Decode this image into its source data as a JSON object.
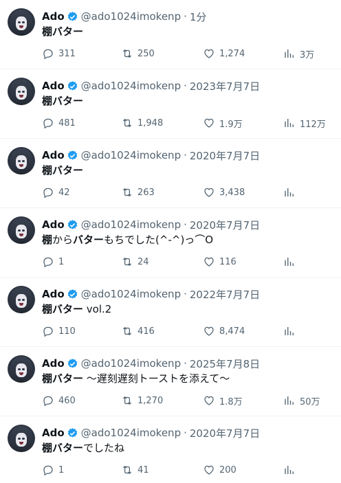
{
  "tweets": [
    {
      "name": "Ado",
      "handle": "@ado1024imokenp",
      "sep": "·",
      "time": "1分",
      "text": [
        {
          "t": "棚バター",
          "b": true
        }
      ],
      "replies": "311",
      "retweets": "250",
      "likes": "1,274",
      "views": "3万"
    },
    {
      "name": "Ado",
      "handle": "@ado1024imokenp",
      "sep": "·",
      "time": "2023年7月7日",
      "text": [
        {
          "t": "棚バター",
          "b": true
        }
      ],
      "replies": "481",
      "retweets": "1,948",
      "likes": "1.9万",
      "views": "112万"
    },
    {
      "name": "Ado",
      "handle": "@ado1024imokenp",
      "sep": "·",
      "time": "2020年7月7日",
      "text": [
        {
          "t": "棚バター",
          "b": true
        }
      ],
      "replies": "42",
      "retweets": "263",
      "likes": "3,438",
      "views": ""
    },
    {
      "name": "Ado",
      "handle": "@ado1024imokenp",
      "sep": "·",
      "time": "2020年7月7日",
      "text": [
        {
          "t": "棚",
          "b": true
        },
        {
          "t": "から",
          "b": false
        },
        {
          "t": "バター",
          "b": true
        },
        {
          "t": "もちでした(^-^)っ⌒O",
          "b": false
        }
      ],
      "replies": "1",
      "retweets": "24",
      "likes": "116",
      "views": ""
    },
    {
      "name": "Ado",
      "handle": "@ado1024imokenp",
      "sep": "·",
      "time": "2022年7月7日",
      "text": [
        {
          "t": "棚バター",
          "b": true
        },
        {
          "t": " vol.2",
          "b": false
        }
      ],
      "replies": "110",
      "retweets": "416",
      "likes": "8,474",
      "views": ""
    },
    {
      "name": "Ado",
      "handle": "@ado1024imokenp",
      "sep": "·",
      "time": "2025年7月8日",
      "text": [
        {
          "t": "棚バター",
          "b": true
        },
        {
          "t": " 〜遅刻遅刻トーストを添えて〜",
          "b": false
        }
      ],
      "replies": "460",
      "retweets": "1,270",
      "likes": "1.8万",
      "views": "50万"
    },
    {
      "name": "Ado",
      "handle": "@ado1024imokenp",
      "sep": "·",
      "time": "2020年7月7日",
      "text": [
        {
          "t": "棚バター",
          "b": true
        },
        {
          "t": "でしたね",
          "b": false
        }
      ],
      "replies": "1",
      "retweets": "41",
      "likes": "200",
      "views": ""
    }
  ],
  "colors": {
    "text": "#0f1419",
    "muted": "#536471",
    "verified": "#1d9bf0",
    "divider": "#eff3f4"
  },
  "icons": {
    "reply": "reply-icon",
    "retweet": "retweet-icon",
    "like": "heart-icon",
    "views": "views-bar-chart-icon",
    "verified": "verified-badge-icon"
  }
}
